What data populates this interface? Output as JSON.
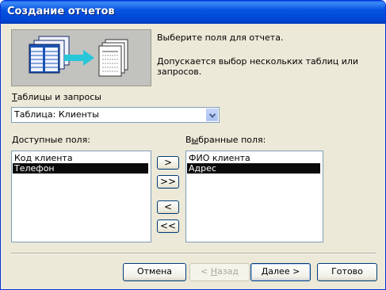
{
  "window": {
    "title": "Создание отчетов"
  },
  "intro": {
    "line1": "Выберите поля для отчета.",
    "line2": "Допускается выбор нескольких таблиц или запросов."
  },
  "tables": {
    "label_underlined": "Т",
    "label_rest": "аблицы и запросы",
    "selected": "Таблица: Клиенты"
  },
  "available": {
    "label_underlined": "Д",
    "label_rest": "оступные поля:",
    "items": [
      {
        "label": "Код клиента",
        "selected": false
      },
      {
        "label": "Телефон",
        "selected": true
      }
    ]
  },
  "selected_fields": {
    "label_pre": "В",
    "label_underlined": "ы",
    "label_rest": "бранные поля:",
    "items": [
      {
        "label": "ФИО клиента",
        "selected": false
      },
      {
        "label": "Адрес",
        "selected": true
      }
    ]
  },
  "move_buttons": {
    "add_one": ">",
    "add_all": ">>",
    "remove_one": "<",
    "remove_all": "<<"
  },
  "buttons": {
    "cancel": "Отмена",
    "back_pre": "< ",
    "back_underlined": "Н",
    "back_rest": "азад",
    "next_underlined": "Д",
    "next_rest": "алее >",
    "finish": "Готово"
  },
  "colors": {
    "title_bar": "#0054e3",
    "dialog_bg": "#ece9d8",
    "selection": "#0a0a0a"
  },
  "icons": [
    "tables-to-report-illustration",
    "chevron-down-icon"
  ]
}
